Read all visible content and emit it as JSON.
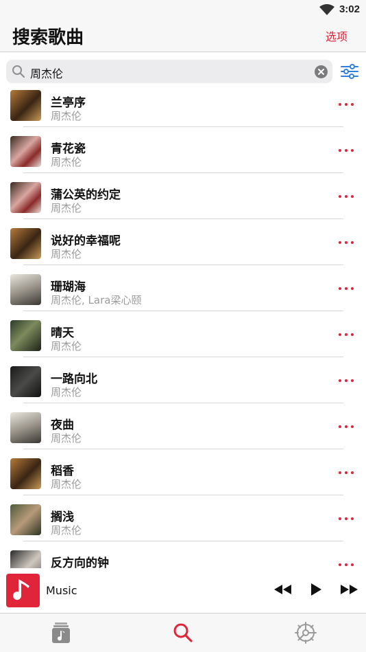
{
  "status_bar": {
    "time": "3:02"
  },
  "header": {
    "title": "搜索歌曲",
    "options_label": "选项"
  },
  "search": {
    "value": "周杰伦"
  },
  "songs": [
    {
      "title": "兰亭序",
      "artist": "周杰伦"
    },
    {
      "title": "青花瓷",
      "artist": "周杰伦"
    },
    {
      "title": "蒲公英的约定",
      "artist": "周杰伦"
    },
    {
      "title": "说好的幸福呢",
      "artist": "周杰伦"
    },
    {
      "title": "珊瑚海",
      "artist": "周杰伦, Lara梁心颐"
    },
    {
      "title": "晴天",
      "artist": "周杰伦"
    },
    {
      "title": "一路向北",
      "artist": "周杰伦"
    },
    {
      "title": "夜曲",
      "artist": "周杰伦"
    },
    {
      "title": "稻香",
      "artist": "周杰伦"
    },
    {
      "title": "搁浅",
      "artist": "周杰伦"
    },
    {
      "title": "反方向的钟",
      "artist": ""
    }
  ],
  "player": {
    "track_title": "Music"
  },
  "tabs": [
    {
      "icon": "music-library-icon",
      "active": false
    },
    {
      "icon": "search-icon",
      "active": true
    },
    {
      "icon": "settings-gear-icon",
      "active": false
    }
  ],
  "colors": {
    "accent": "#e0253a",
    "secondary_text": "#9a9a9a",
    "filter_blue": "#2f7fe0"
  }
}
